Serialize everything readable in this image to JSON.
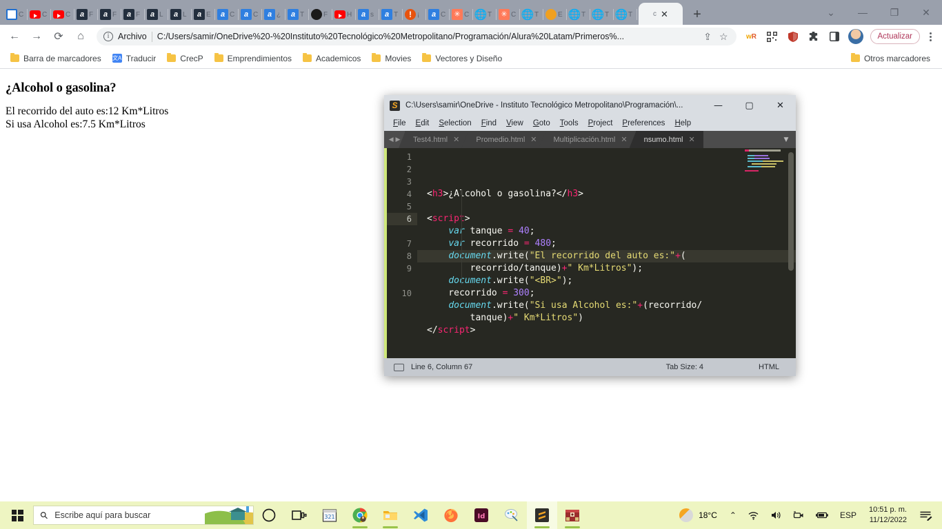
{
  "browser": {
    "mini_tabs": [
      {
        "icon": "window-icon",
        "kind": "win",
        "label": "C"
      },
      {
        "icon": "youtube-icon",
        "kind": "yt",
        "label": "C"
      },
      {
        "icon": "youtube-icon",
        "kind": "yt",
        "label": "C"
      },
      {
        "icon": "amazon-icon",
        "kind": "amazon",
        "label": "F"
      },
      {
        "icon": "amazon-icon",
        "kind": "amazon",
        "label": "F"
      },
      {
        "icon": "amazon-icon",
        "kind": "amazon",
        "label": "F"
      },
      {
        "icon": "amazon-icon",
        "kind": "amazon",
        "label": "L"
      },
      {
        "icon": "amazon-icon",
        "kind": "amazon",
        "label": "L"
      },
      {
        "icon": "amazon-icon",
        "kind": "amazon",
        "label": "E"
      },
      {
        "icon": "amazon-icon",
        "kind": "amazon-blue",
        "label": "C"
      },
      {
        "icon": "amazon-icon",
        "kind": "amazon-blue",
        "label": "C"
      },
      {
        "icon": "amazon-icon",
        "kind": "amazon-blue",
        "label": "¿"
      },
      {
        "icon": "amazon-icon",
        "kind": "amazon-blue",
        "label": "T"
      },
      {
        "icon": "circle-icon",
        "kind": "black",
        "label": "F"
      },
      {
        "icon": "youtube-icon",
        "kind": "yt",
        "label": "H"
      },
      {
        "icon": "amazon-icon",
        "kind": "amazon-blue",
        "label": "s"
      },
      {
        "icon": "amazon-icon",
        "kind": "amazon-blue",
        "label": "T"
      },
      {
        "icon": "alert-icon",
        "kind": "alert",
        "label": "¡"
      },
      {
        "icon": "amazon-icon",
        "kind": "amazon-blue",
        "label": "C"
      },
      {
        "icon": "hubspot-icon",
        "kind": "hub",
        "label": "C"
      },
      {
        "icon": "globe-icon",
        "kind": "globe",
        "label": "T"
      },
      {
        "icon": "hubspot-icon",
        "kind": "hub",
        "label": "C"
      },
      {
        "icon": "globe-icon",
        "kind": "globe",
        "label": "T"
      },
      {
        "icon": "orange-dot-icon",
        "kind": "orange",
        "label": "E"
      },
      {
        "icon": "globe-icon",
        "kind": "globe",
        "label": "T"
      },
      {
        "icon": "globe-icon",
        "kind": "globe",
        "label": "T"
      },
      {
        "icon": "globe-icon",
        "kind": "globe",
        "label": "T"
      }
    ],
    "active_tab": {
      "label": "c",
      "close": "✕"
    },
    "new_tab_label": "+",
    "window_controls": {
      "minimize": "—",
      "maximize": "❐",
      "close": "✕",
      "tabsearch": "⌄"
    },
    "toolbar": {
      "back": "←",
      "forward": "→",
      "reload": "⟳",
      "home": "⌂",
      "share": "⇪",
      "bookmark_star": "☆",
      "update_label": "Actualizar",
      "extensions": [
        "wR",
        "qr-code-icon",
        "shield-icon",
        "puzzle-icon",
        "sidepanel-icon"
      ]
    },
    "omnibox": {
      "scheme_label": "Archivo",
      "url": "C:/Users/samir/OneDrive%20-%20Instituto%20Tecnológico%20Metropolitano/Programación/Alura%20Latam/Primeros%...",
      "info_glyph": "i"
    },
    "bookmarks": [
      {
        "label": "Barra de marcadores",
        "icon": "folder-icon"
      },
      {
        "label": "Traducir",
        "icon": "translate-icon"
      },
      {
        "label": "CrecP",
        "icon": "folder-icon"
      },
      {
        "label": "Emprendimientos",
        "icon": "folder-icon"
      },
      {
        "label": "Academicos",
        "icon": "folder-icon"
      },
      {
        "label": "Movies",
        "icon": "folder-icon"
      },
      {
        "label": "Vectores y Diseño",
        "icon": "folder-icon"
      }
    ],
    "bookmarks_overflow": {
      "label": "Otros marcadores",
      "icon": "folder-icon"
    }
  },
  "page": {
    "heading": "¿Alcohol o gasolina?",
    "lines": [
      "El recorrido del auto es:12 Km*Litros",
      "Si usa Alcohol es:7.5 Km*Litros"
    ]
  },
  "sublime": {
    "title": "C:\\Users\\samir\\OneDrive - Instituto Tecnológico Metropolitano\\Programación\\...",
    "window_controls": {
      "minimize": "—",
      "maximize": "▢",
      "close": "✕"
    },
    "menu": [
      "File",
      "Edit",
      "Selection",
      "Find",
      "View",
      "Goto",
      "Tools",
      "Project",
      "Preferences",
      "Help"
    ],
    "tabs": [
      {
        "label": "Test4.html",
        "active": false,
        "close": "✕"
      },
      {
        "label": "Promedio.html",
        "active": false,
        "close": "✕"
      },
      {
        "label": "Multiplicación.html",
        "active": false,
        "close": "✕"
      },
      {
        "label": "nsumo.html",
        "active": true,
        "close": "✕"
      }
    ],
    "tab_overflow_glyph": "▼",
    "nav_arrows": {
      "left": "◀",
      "right": "▶"
    },
    "gutter": [
      "1",
      "2",
      "3",
      "4",
      "5",
      "6",
      "7",
      "8",
      "9",
      "10"
    ],
    "current_line_index": 5,
    "code_lines": [
      [
        {
          "t": "<",
          "c": "tk-plain"
        },
        {
          "t": "h3",
          "c": "tk-tag"
        },
        {
          "t": ">¿Alcohol o gasolina?</",
          "c": "tk-plain"
        },
        {
          "t": "h3",
          "c": "tk-tag"
        },
        {
          "t": ">",
          "c": "tk-plain"
        }
      ],
      [],
      [
        {
          "t": "<",
          "c": "tk-plain"
        },
        {
          "t": "script",
          "c": "tk-tag"
        },
        {
          "t": ">",
          "c": "tk-plain"
        }
      ],
      [
        {
          "t": "    ",
          "c": "tk-plain"
        },
        {
          "t": "var",
          "c": "tk-kw"
        },
        {
          "t": " tanque ",
          "c": "tk-plain"
        },
        {
          "t": "=",
          "c": "tk-op"
        },
        {
          "t": " ",
          "c": "tk-plain"
        },
        {
          "t": "40",
          "c": "tk-num"
        },
        {
          "t": ";",
          "c": "tk-plain"
        }
      ],
      [
        {
          "t": "    ",
          "c": "tk-plain"
        },
        {
          "t": "var",
          "c": "tk-kw"
        },
        {
          "t": " recorrido ",
          "c": "tk-plain"
        },
        {
          "t": "=",
          "c": "tk-op"
        },
        {
          "t": " ",
          "c": "tk-plain"
        },
        {
          "t": "480",
          "c": "tk-num"
        },
        {
          "t": ";",
          "c": "tk-plain"
        }
      ],
      [
        {
          "t": "    ",
          "c": "tk-plain"
        },
        {
          "t": "document",
          "c": "tk-fn"
        },
        {
          "t": ".write(",
          "c": "tk-plain"
        },
        {
          "t": "\"El recorrido del auto es:\"",
          "c": "tk-str"
        },
        {
          "t": "+",
          "c": "tk-op"
        },
        {
          "t": "(",
          "c": "tk-plain"
        }
      ],
      [
        {
          "t": "        recorrido/tanque)",
          "c": "tk-plain"
        },
        {
          "t": "+",
          "c": "tk-op"
        },
        {
          "t": "\" Km*Litros\"",
          "c": "tk-str"
        },
        {
          "t": ");",
          "c": "tk-plain"
        }
      ],
      [
        {
          "t": "    ",
          "c": "tk-plain"
        },
        {
          "t": "document",
          "c": "tk-fn"
        },
        {
          "t": ".write(",
          "c": "tk-plain"
        },
        {
          "t": "\"<BR>\"",
          "c": "tk-str"
        },
        {
          "t": ");",
          "c": "tk-plain"
        }
      ],
      [
        {
          "t": "    recorrido ",
          "c": "tk-plain"
        },
        {
          "t": "=",
          "c": "tk-op"
        },
        {
          "t": " ",
          "c": "tk-plain"
        },
        {
          "t": "300",
          "c": "tk-num"
        },
        {
          "t": ";",
          "c": "tk-plain"
        }
      ],
      [
        {
          "t": "    ",
          "c": "tk-plain"
        },
        {
          "t": "document",
          "c": "tk-fn"
        },
        {
          "t": ".write(",
          "c": "tk-plain"
        },
        {
          "t": "\"Si usa Alcohol es:\"",
          "c": "tk-str"
        },
        {
          "t": "+",
          "c": "tk-op"
        },
        {
          "t": "(recorrido/",
          "c": "tk-plain"
        }
      ],
      [
        {
          "t": "        tanque)",
          "c": "tk-plain"
        },
        {
          "t": "+",
          "c": "tk-op"
        },
        {
          "t": "\" Km*Litros\"",
          "c": "tk-str"
        },
        {
          "t": ")",
          "c": "tk-plain"
        }
      ],
      [
        {
          "t": "</",
          "c": "tk-plain"
        },
        {
          "t": "script",
          "c": "tk-tag"
        },
        {
          "t": ">",
          "c": "tk-plain"
        }
      ]
    ],
    "code_row_current_index": 5,
    "statusbar": {
      "position": "Line 6, Column 67",
      "tab_size": "Tab Size: 4",
      "syntax": "HTML"
    }
  },
  "taskbar": {
    "search_placeholder": "Escribe aquí para buscar",
    "apps": [
      {
        "name": "cortana-icon",
        "running": false
      },
      {
        "name": "task-view-icon",
        "running": false
      },
      {
        "name": "calendar-321-icon",
        "running": false
      },
      {
        "name": "chrome-icon",
        "running": true
      },
      {
        "name": "file-explorer-icon",
        "running": true
      },
      {
        "name": "vscode-icon",
        "running": false
      },
      {
        "name": "firefox-icon",
        "running": false
      },
      {
        "name": "indesign-icon",
        "running": false
      },
      {
        "name": "paint-net-icon",
        "running": false
      },
      {
        "name": "sublime-text-icon",
        "running": true,
        "active": true
      },
      {
        "name": "winrar-icon",
        "running": true
      }
    ],
    "tray": {
      "temperature": "18°C",
      "chevron": "⌃",
      "wifi": "wifi-icon",
      "volume": "volume-icon",
      "camera": "camera-icon",
      "battery": "battery-icon",
      "language": "ESP",
      "time": "10:51 p. m.",
      "date": "11/12/2022",
      "notifications": "notifications-icon"
    }
  },
  "colors": {
    "accent": "#cfe87a",
    "editor_bg": "#272822",
    "string": "#e6db74",
    "tag": "#f92672",
    "number": "#ae81ff",
    "keyword": "#66d9ef",
    "taskbar": "#eef5c2"
  }
}
